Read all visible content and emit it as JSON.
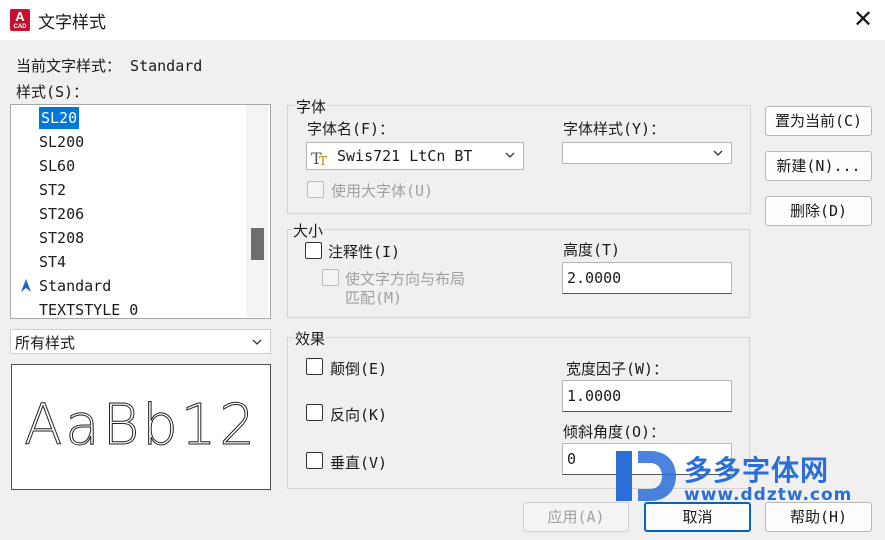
{
  "window": {
    "title": "文字样式",
    "app_icon_letter": "A",
    "app_icon_sub": "CAD",
    "close_symbol": "✕"
  },
  "current_style": {
    "label": "当前文字样式：",
    "value": "Standard"
  },
  "styles": {
    "label": "样式(S)：",
    "items": [
      "SL20",
      "SL200",
      "SL60",
      "ST2",
      "ST206",
      "ST208",
      "ST4",
      "Standard",
      "TEXTSTYLE_0"
    ],
    "selected_index": 0,
    "annotative_icon_item": "Standard",
    "filter_value": "所有样式"
  },
  "preview": {
    "text": "AaBb12"
  },
  "font": {
    "group_title": "字体",
    "name_label": "字体名(F)：",
    "name_value": "Swis721 LtCn BT",
    "name_icon": "truetype-font-icon",
    "style_label": "字体样式(Y)：",
    "style_value": "",
    "bigfont_label": "使用大字体(U)",
    "bigfont_checked": false,
    "bigfont_enabled": false
  },
  "size": {
    "group_title": "大小",
    "annotative_label": "注释性(I)",
    "annotative_checked": false,
    "match_label_line1": "使文字方向与布局",
    "match_label_line2": "匹配(M)",
    "match_checked": false,
    "match_enabled": false,
    "height_label": "高度(T)",
    "height_value": "2.0000"
  },
  "effects": {
    "group_title": "效果",
    "upside_down_label": "颠倒(E)",
    "backwards_label": "反向(K)",
    "vertical_label": "垂直(V)",
    "upside_down_checked": false,
    "backwards_checked": false,
    "vertical_checked": false,
    "width_label": "宽度因子(W)：",
    "width_value": "1.0000",
    "oblique_label": "倾斜角度(O)：",
    "oblique_value": "0"
  },
  "buttons": {
    "set_current": "置为当前(C)",
    "new": "新建(N)...",
    "delete": "删除(D)",
    "apply": "应用(A)",
    "cancel": "取消",
    "help": "帮助(H)"
  },
  "watermark": {
    "line1": "多多字体网",
    "line2": "www.ddztw.com"
  },
  "colors": {
    "selection": "#0078d7",
    "accent": "#0067c0",
    "watermark": "#2a6fd8"
  }
}
